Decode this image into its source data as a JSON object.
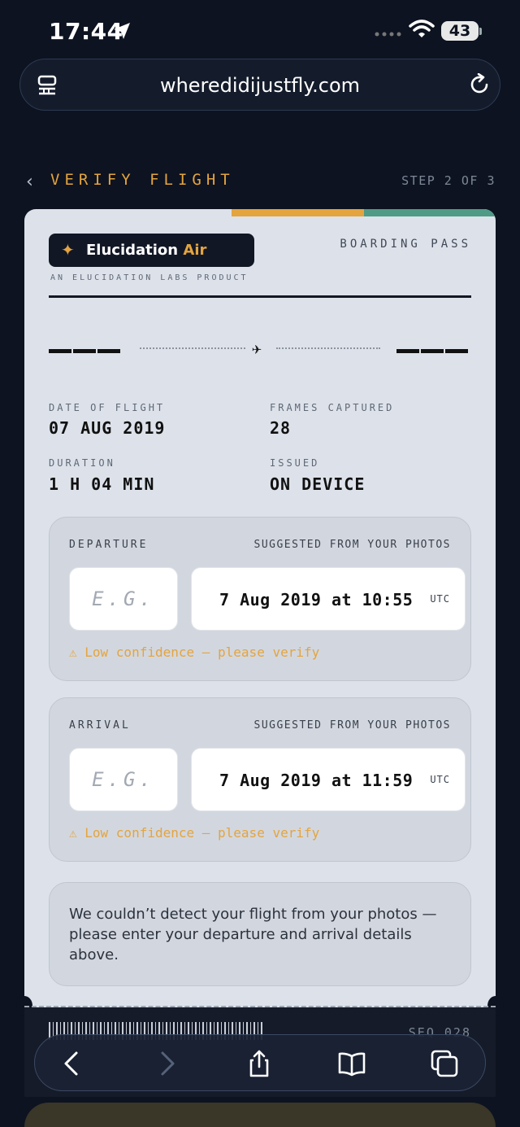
{
  "status_bar": {
    "time": "17:44",
    "battery": "43"
  },
  "browser": {
    "url": "wheredidijustfly.com"
  },
  "header": {
    "back": "‹",
    "title": "VERIFY FLIGHT",
    "step": "STEP 2 OF 3"
  },
  "ticket": {
    "brand_name": "Elucidation",
    "brand_accent": "Air",
    "tagline": "AN ELUCIDATION LABS PRODUCT",
    "pass_label": "BOARDING PASS",
    "details": {
      "date_label": "DATE OF FLIGHT",
      "date": "07 AUG 2019",
      "frames_label": "FRAMES CAPTURED",
      "frames": "28",
      "duration_label": "DURATION",
      "duration": "1 H 04 MIN",
      "issued_label": "ISSUED",
      "issued": "ON DEVICE"
    },
    "departure": {
      "label": "DEPARTURE",
      "suggested": "SUGGESTED FROM YOUR PHOTOS",
      "code_placeholder": "E.G.",
      "time": "7 Aug 2019 at 10:55",
      "tz": "UTC",
      "warning": "⚠ Low confidence — please verify"
    },
    "arrival": {
      "label": "ARRIVAL",
      "suggested": "SUGGESTED FROM YOUR PHOTOS",
      "code_placeholder": "E.G.",
      "time": "7 Aug 2019 at 11:59",
      "tz": "UTC",
      "warning": "⚠ Low confidence — please verify"
    },
    "message": "We couldn’t detect your flight from your photos — please enter your departure and arrival details above.",
    "seq": "SEQ 028"
  },
  "colors": {
    "accent": "#e4a43e",
    "teal": "#4f9b86",
    "background": "#0d1320",
    "ticket": "#dde2ea"
  }
}
